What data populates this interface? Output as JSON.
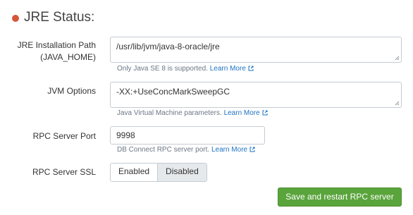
{
  "section": {
    "title": "JRE Status:",
    "status_color": "#d6563c"
  },
  "fields": {
    "jre_path": {
      "label_line1": "JRE Installation Path",
      "label_line2": "(JAVA_HOME)",
      "value": "/usr/lib/jvm/java-8-oracle/jre",
      "help": "Only Java SE 8 is supported.",
      "learn_more": "Learn More"
    },
    "jvm_options": {
      "label": "JVM Options",
      "value": "-XX:+UseConcMarkSweepGC",
      "help": "Java Virtual Machine parameters.",
      "learn_more": "Learn More"
    },
    "rpc_port": {
      "label": "RPC Server Port",
      "value": "9998",
      "help": "DB Connect RPC server port.",
      "learn_more": "Learn More"
    },
    "rpc_ssl": {
      "label": "RPC Server SSL",
      "options": [
        "Enabled",
        "Disabled"
      ],
      "selected": "Enabled"
    }
  },
  "actions": {
    "save_label": "Save and restart RPC server",
    "accent": "#5aa43c"
  }
}
